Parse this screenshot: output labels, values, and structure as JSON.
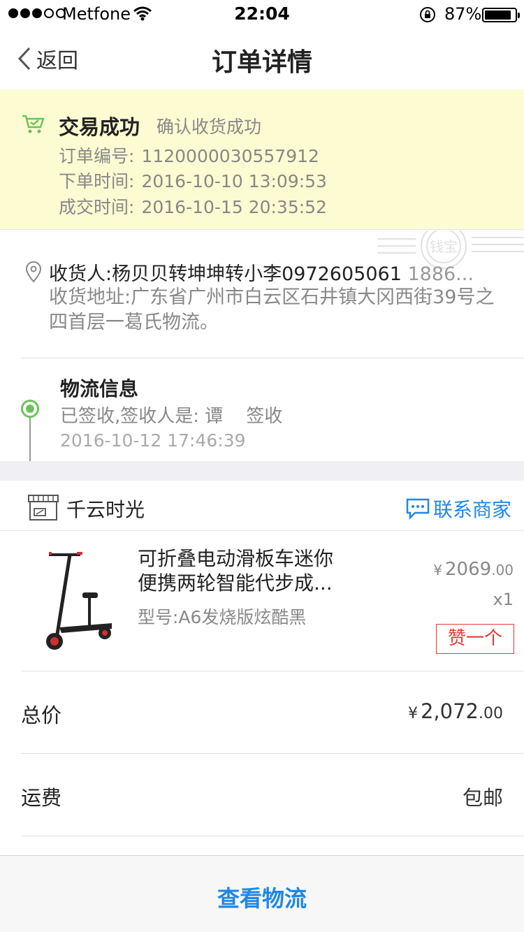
{
  "status_bar": {
    "carrier": "Metfone",
    "time": "22:04",
    "battery": "87%",
    "battery_level": 0.87
  },
  "nav": {
    "back_label": "返回",
    "title": "订单详情"
  },
  "order_status": {
    "status": "交易成功",
    "status_detail": "确认收货成功",
    "order_no_label": "订单编号:",
    "order_no": "1120000030557912",
    "order_time_label": "下单时间:",
    "order_time": "2016-10-10 13:09:53",
    "deal_time_label": "成交时间:",
    "deal_time": "2016-10-15 20:35:52",
    "accent_color": "#6cc35d"
  },
  "stamp_text": "钱宝",
  "address": {
    "receiver": "收货人:杨贝贝转坤坤转小李0972605061",
    "receiver_more": " 1886...",
    "address": "收货地址:广东省广州市白云区石井镇大冈西街39号之四首层一葛氏物流。"
  },
  "logistics": {
    "title": "物流信息",
    "status": "已签收,签收人是: 谭    签收",
    "time": "2016-10-12 17:46:39"
  },
  "shop": {
    "name": "千云时光",
    "contact_label": "联系商家",
    "link_color": "#1e88e5"
  },
  "product": {
    "name_line1": "可折叠电动滑板车迷你",
    "name_line2": "便携两轮智能代步成...",
    "model": "型号:A6发烧版炫酷黑",
    "currency": "¥",
    "price_int": "2069",
    "price_dec": ".00",
    "quantity": "x1",
    "like_label": "赞一个"
  },
  "summary": {
    "total_label": "总价",
    "total_currency": "¥",
    "total_int": "2,072",
    "total_dec": ".00",
    "shipping_label": "运费",
    "shipping_value": "包邮"
  },
  "bottom": {
    "button_label": "查看物流"
  }
}
